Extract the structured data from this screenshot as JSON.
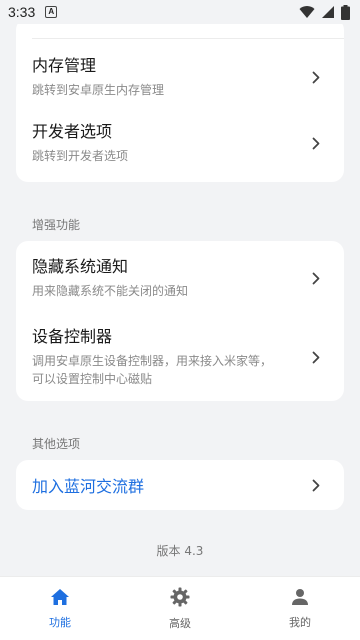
{
  "status_bar": {
    "time": "3:33",
    "notif_icon": "A"
  },
  "cards": {
    "card1": [
      {
        "title": "内存管理",
        "subtitle": "跳转到安卓原生内存管理"
      },
      {
        "title": "开发者选项",
        "subtitle": "跳转到开发者选项"
      }
    ],
    "enhance": {
      "section_label": "增强功能",
      "items": [
        {
          "title": "隐藏系统通知",
          "subtitle": "用来隐藏系统不能关闭的通知"
        },
        {
          "title": "设备控制器",
          "subtitle_line1": "调用安卓原生设备控制器，用来接入米家等，",
          "subtitle_line2": "可以设置控制中心磁贴"
        }
      ]
    },
    "other": {
      "section_label": "其他选项",
      "items": [
        {
          "title": "加入蓝河交流群"
        }
      ]
    }
  },
  "version_text": "版本 4.3",
  "bottom_nav": {
    "items": [
      {
        "label": "功能",
        "icon": "home-icon",
        "active": true
      },
      {
        "label": "高级",
        "icon": "gear-icon",
        "active": false
      },
      {
        "label": "我的",
        "icon": "person-icon",
        "active": false
      }
    ]
  },
  "colors": {
    "accent": "#1e6fe0",
    "background": "#f2f3f5",
    "card": "#ffffff"
  }
}
